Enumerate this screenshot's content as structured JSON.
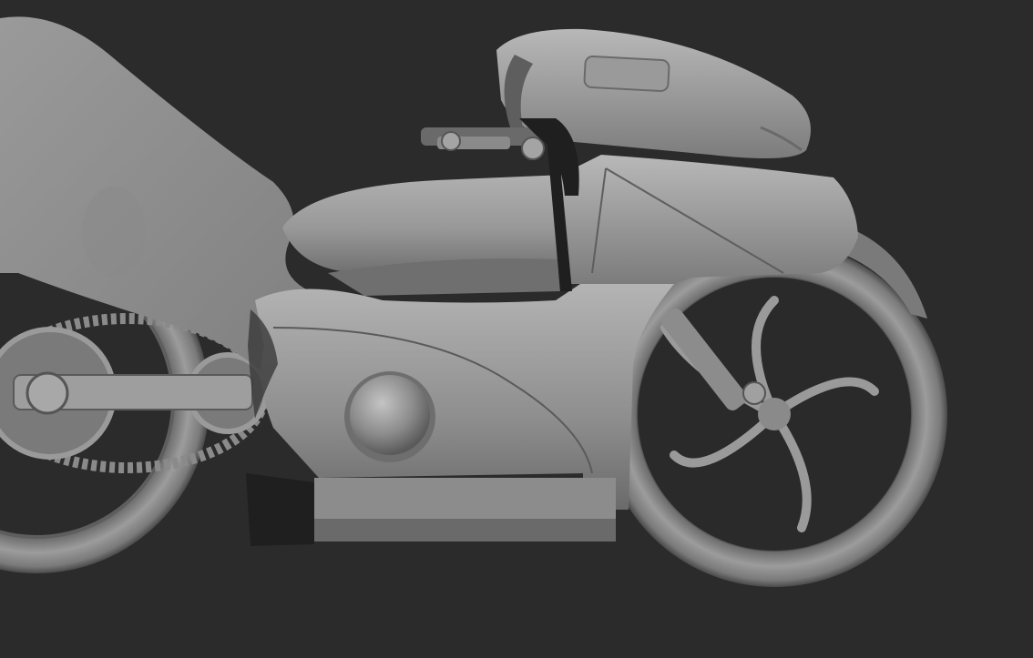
{
  "scene": {
    "subject": "motorcycle-sculpt-render",
    "colors": {
      "background": "#2b2b2b",
      "clay_light": "#a9a9a9",
      "clay_mid": "#8a8a8a",
      "clay_dark": "#5c5c5c",
      "shadow": "#1c1c1c"
    }
  }
}
